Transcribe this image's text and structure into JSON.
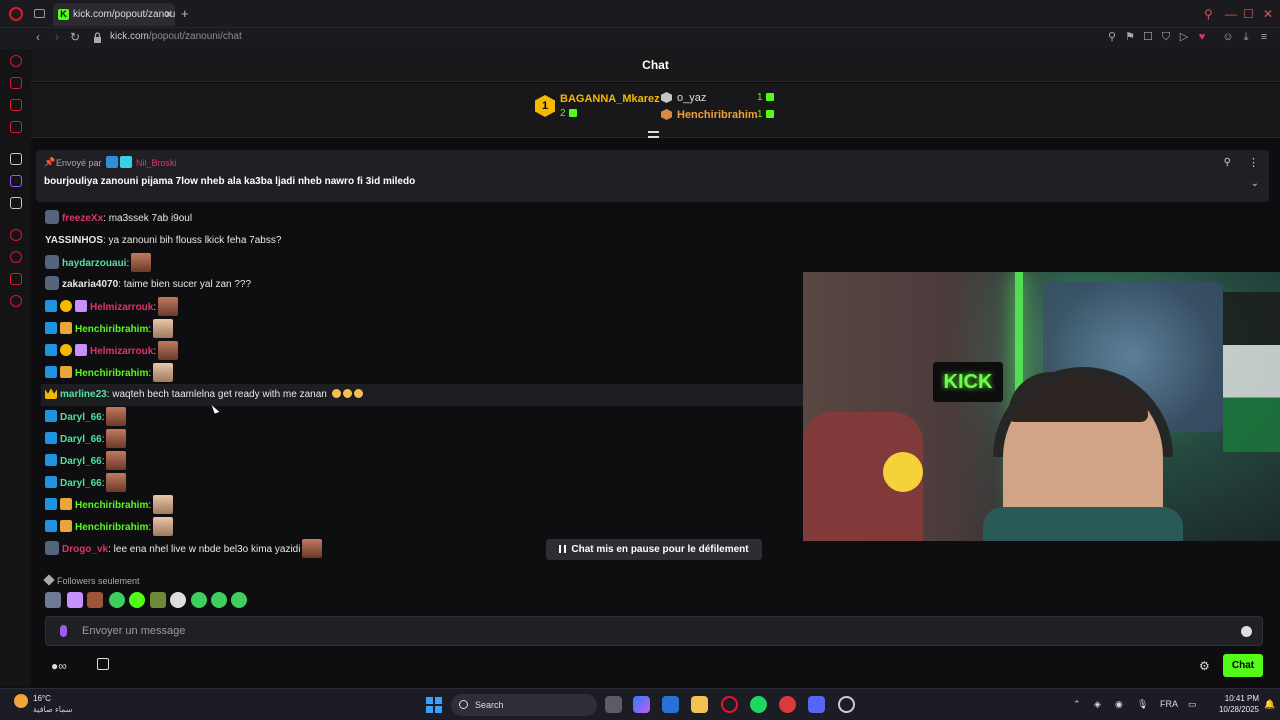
{
  "browser": {
    "tab_title": "kick.com/popout/zanouni",
    "tab_favicon": "K",
    "url_domain": "kick.com",
    "url_path": "/popout/zanouni/chat"
  },
  "chat": {
    "title": "Chat",
    "leaderboard": {
      "first": {
        "name": "BAGANNA_Mkarez",
        "count": "2",
        "rank": "1"
      },
      "second": {
        "name": "o_yaz",
        "count": "1"
      },
      "third": {
        "name": "Henchiribrahim",
        "count": "1"
      }
    },
    "pinned": {
      "label": "Envoyé par",
      "user": "Nil_Broski",
      "text": "bourjouliya zanouni pijama 7low nheb ala ka3ba ljadi nheb nawro fi 3id miledo"
    },
    "messages": [
      {
        "user": "freezeXx",
        "color": "#e0326a",
        "text": ": ma3ssek 7ab i9oul"
      },
      {
        "user": "YASSINHOS",
        "color": "#e8e8e8",
        "text": ": ya zanouni bih flouss lkick feha 7abss?"
      },
      {
        "user": "haydarzouaui",
        "color": "#53e0a0",
        "text": ":"
      },
      {
        "user": "zakaria4070",
        "color": "#e8e8e8",
        "text": ": taime bien sucer yal zan ???"
      },
      {
        "user": "Helmizarrouk",
        "color": "#e0326a",
        "text": ":"
      },
      {
        "user": "Henchiribrahim",
        "color": "#53fc18",
        "text": ":"
      },
      {
        "user": "Helmizarrouk",
        "color": "#e0326a",
        "text": ":"
      },
      {
        "user": "Henchiribrahim",
        "color": "#53fc18",
        "text": ":"
      },
      {
        "user": "marline23",
        "color": "#53e0a0",
        "text": ": waqteh bech taamlelna get ready with me zanan"
      },
      {
        "user": "Daryl_66",
        "color": "#53e0a0",
        "text": ":"
      },
      {
        "user": "Daryl_66",
        "color": "#53e0a0",
        "text": ":"
      },
      {
        "user": "Daryl_66",
        "color": "#53e0a0",
        "text": ":"
      },
      {
        "user": "Daryl_66",
        "color": "#53e0a0",
        "text": ":"
      },
      {
        "user": "Henchiribrahim",
        "color": "#53fc18",
        "text": ":"
      },
      {
        "user": "Henchiribrahim",
        "color": "#53fc18",
        "text": ":"
      },
      {
        "user": "Drogo_vk",
        "color": "#e0326a",
        "text": ": lee ena nhel live w nbde bel3o kima yazidi"
      }
    ],
    "paused_label": "Chat mis en pause pour le défilement",
    "followers_only": "Followers seulement",
    "input_placeholder": "Envoyer un message",
    "send_label": "Chat",
    "webcam_sign": "KICK"
  },
  "taskbar": {
    "temperature": "16°C",
    "weather": "سماء صافية",
    "search": "Search",
    "language": "FRA",
    "time": "10:41 PM",
    "date": "10/28/2025"
  },
  "colors": {
    "kick_green": "#53fc18",
    "accent_red": "#e0182f"
  }
}
